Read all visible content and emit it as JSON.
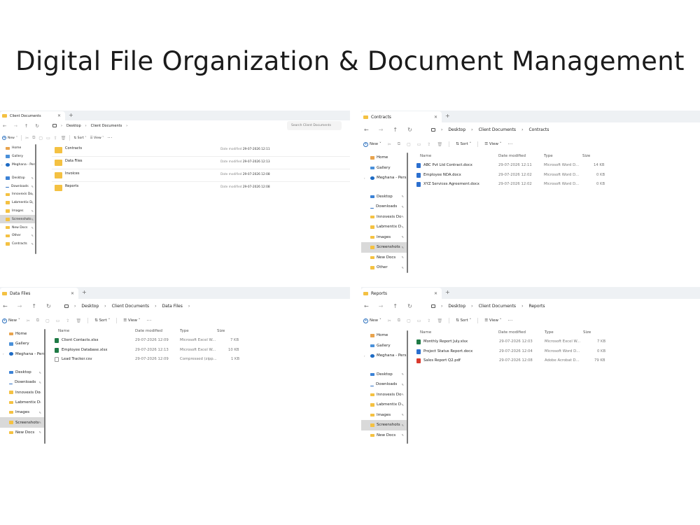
{
  "page_title": "Digital File Organization & Document Management",
  "common": {
    "new_label": "New",
    "sort_label": "Sort",
    "view_label": "View",
    "more_label": "···",
    "desktop": "Desktop",
    "client_documents": "Client Documents",
    "col_name": "Name",
    "col_date": "Date modified",
    "col_type": "Type",
    "col_size": "Size",
    "date_modified_label": "Date modified",
    "sidebar": {
      "home": "Home",
      "gallery": "Gallery",
      "meghana": "Meghana - Pers",
      "desktop": "Desktop",
      "downloads": "Downloads",
      "innovexis": "Innovexis Do",
      "labmentix": "Labmentix D",
      "images": "Images",
      "screenshots": "Screenshots",
      "newdocs": "New Docs",
      "other": "Other",
      "contracts": "Contracts"
    }
  },
  "w1": {
    "tab": "Client Documents",
    "search_placeholder": "Search Client Documents",
    "folders": [
      {
        "name": "Contracts",
        "date": "29-07-2026 12:11"
      },
      {
        "name": "Data Files",
        "date": "29-07-2026 12:13"
      },
      {
        "name": "Invoices",
        "date": "29-07-2026 12:08"
      },
      {
        "name": "Reports",
        "date": "29-07-2026 12:08"
      }
    ]
  },
  "w2": {
    "tab": "Contracts",
    "crumb": "Contracts",
    "files": [
      {
        "name": "ABC Pvt Ltd Contract.docx",
        "date": "29-07-2026 12:11",
        "type": "Microsoft Word D...",
        "size": "14 KB"
      },
      {
        "name": "Employee NDA.docx",
        "date": "29-07-2026 12:02",
        "type": "Microsoft Word D...",
        "size": "0 KB"
      },
      {
        "name": "XYZ Services Agreement.docx",
        "date": "29-07-2026 12:02",
        "type": "Microsoft Word D...",
        "size": "0 KB"
      }
    ]
  },
  "w3": {
    "tab": "Data Files",
    "crumb": "Data Files",
    "files": [
      {
        "name": "Client Contacts.xlsx",
        "date": "29-07-2026 12:09",
        "type": "Microsoft Excel W...",
        "size": "7 KB"
      },
      {
        "name": "Employee Database.xlsx",
        "date": "29-07-2026 12:13",
        "type": "Microsoft Excel W...",
        "size": "10 KB"
      },
      {
        "name": "Lead Tracker.csv",
        "date": "29-07-2026 12:09",
        "type": "Compressed (zipp...",
        "size": "1 KB"
      }
    ]
  },
  "w4": {
    "tab": "Reports",
    "crumb": "Reports",
    "files": [
      {
        "name": "Monthly Report July.xlsx",
        "date": "29-07-2026 12:03",
        "type": "Microsoft Excel W...",
        "size": "7 KB"
      },
      {
        "name": "Project Status Report.docx",
        "date": "29-07-2026 12:04",
        "type": "Microsoft Word D...",
        "size": "0 KB"
      },
      {
        "name": "Sales Report Q2.pdf",
        "date": "29-07-2026 12:08",
        "type": "Adobe Acrobat D...",
        "size": "79 KB"
      }
    ]
  }
}
